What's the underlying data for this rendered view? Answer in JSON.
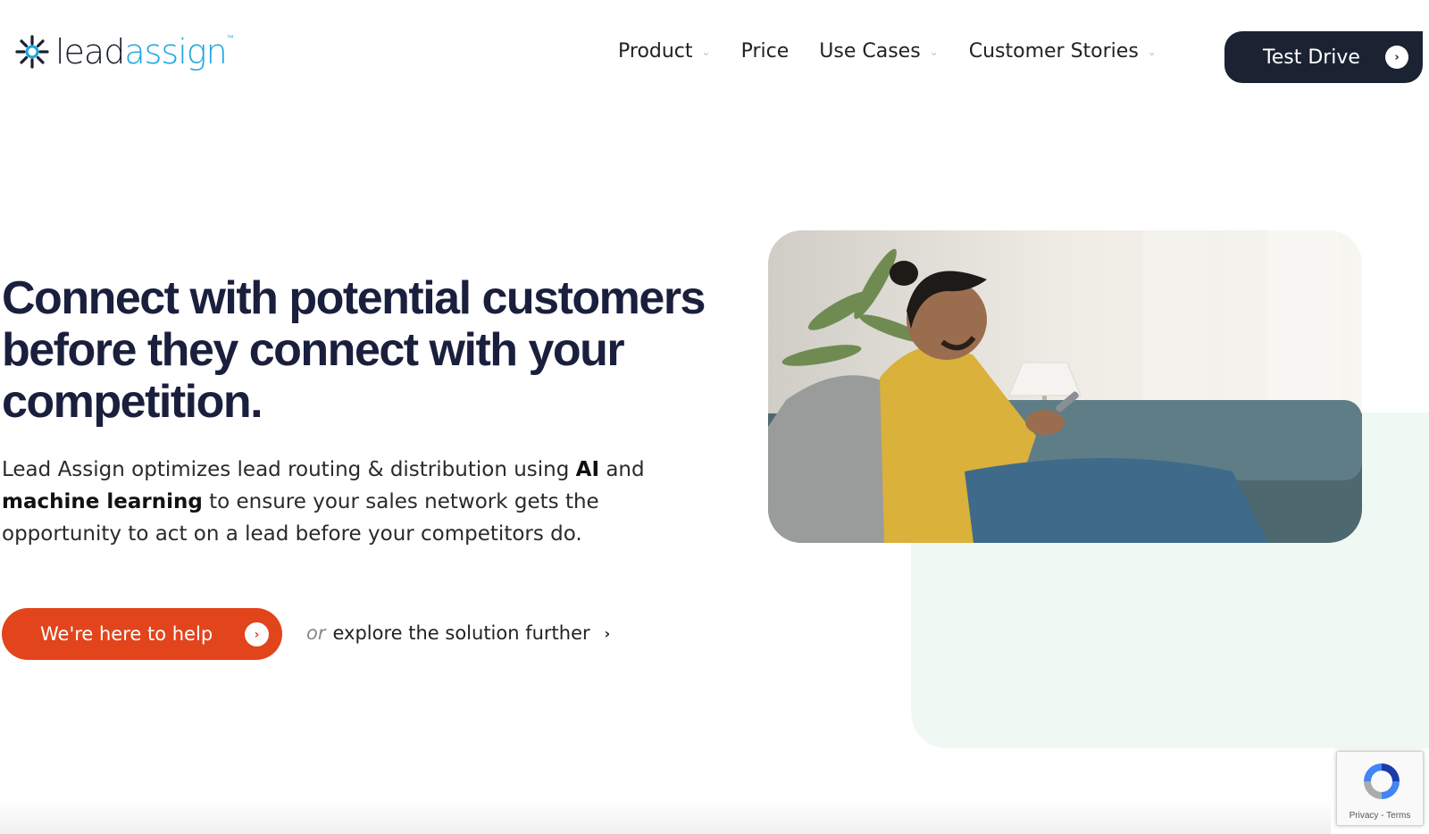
{
  "brand": {
    "lead": "lead",
    "assign": "assign",
    "tm": "™"
  },
  "nav": {
    "items": [
      {
        "label": "Product",
        "has_dropdown": true
      },
      {
        "label": "Price",
        "has_dropdown": false
      },
      {
        "label": "Use Cases",
        "has_dropdown": true
      },
      {
        "label": "Customer Stories",
        "has_dropdown": true
      }
    ],
    "cta_label": "Test Drive",
    "chevron": "⌄",
    "arrow": "›"
  },
  "hero": {
    "headline": "Connect with potential customers before they connect with your competition.",
    "lede": {
      "part1": "Lead Assign optimizes lead routing & distribution using ",
      "bold1": "AI",
      "part2": " and ",
      "bold2": "machine learning",
      "part3": " to ensure your sales network gets the opportunity to act on a lead before your competitors do."
    },
    "cta_label": "We're here to help",
    "cta_arrow": "›",
    "explore_or": "or",
    "explore_label": "explore the solution further",
    "explore_arrow": "›"
  },
  "recaptcha": {
    "links": "Privacy - Terms"
  },
  "colors": {
    "navy": "#1a1f3d",
    "button_dark": "#1b2333",
    "accent_orange": "#e2441c",
    "brand_blue": "#1aa6e0",
    "mint": "#f0f8f3"
  }
}
